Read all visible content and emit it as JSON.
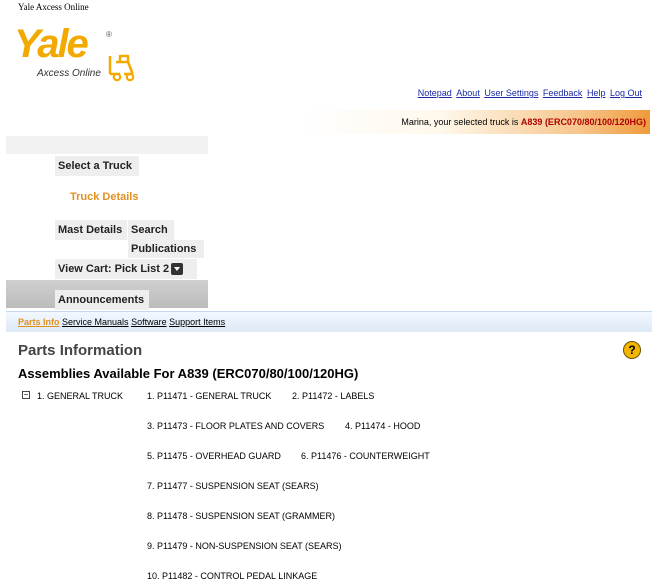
{
  "window_title": "Yale Axcess Online",
  "logo": {
    "word": "Yale",
    "reg": "®",
    "subtitle": "Axcess Online"
  },
  "top_links": [
    "Notepad",
    "About",
    "User Settings",
    "Feedback",
    "Help",
    "Log Out"
  ],
  "selected_truck": {
    "prefix": "Marina, your selected truck is ",
    "truck": "A839 (ERC070/80/100/120HG)"
  },
  "nav": {
    "select_truck": "Select a Truck",
    "truck_details": "Truck Details",
    "mast_details": "Mast Details",
    "search": "Search",
    "publications": "Publications",
    "view_cart": "View Cart: Pick List 2",
    "announcements": "Announcements"
  },
  "tabs": [
    {
      "label": "Parts Info",
      "active": true
    },
    {
      "label": "Service Manuals",
      "active": false
    },
    {
      "label": "Software",
      "active": false
    },
    {
      "label": "Support Items",
      "active": false
    }
  ],
  "page_title": "Parts Information",
  "help_icon": "question-mark-icon",
  "assemblies_title": "Assemblies Available For A839 (ERC070/80/100/120HG)",
  "tree": {
    "toggle": "⊟",
    "root": "1. GENERAL TRUCK",
    "parts": [
      "1. P11471 - GENERAL TRUCK",
      "2. P11472 - LABELS",
      "3. P11473 - FLOOR PLATES AND COVERS",
      "4. P11474 - HOOD",
      "5. P11475 - OVERHEAD GUARD",
      "6. P11476 - COUNTERWEIGHT",
      "7. P11477 - SUSPENSION SEAT (SEARS)",
      "8. P11478 - SUSPENSION SEAT (GRAMMER)",
      "9. P11479 - NON-SUSPENSION SEAT (SEARS)",
      "10. P11482 - CONTROL PEDAL LINKAGE"
    ]
  },
  "colors": {
    "brand": "#f2a900",
    "accent": "#e2901e",
    "link": "#1a2aa6",
    "truck_id": "#b00000"
  }
}
